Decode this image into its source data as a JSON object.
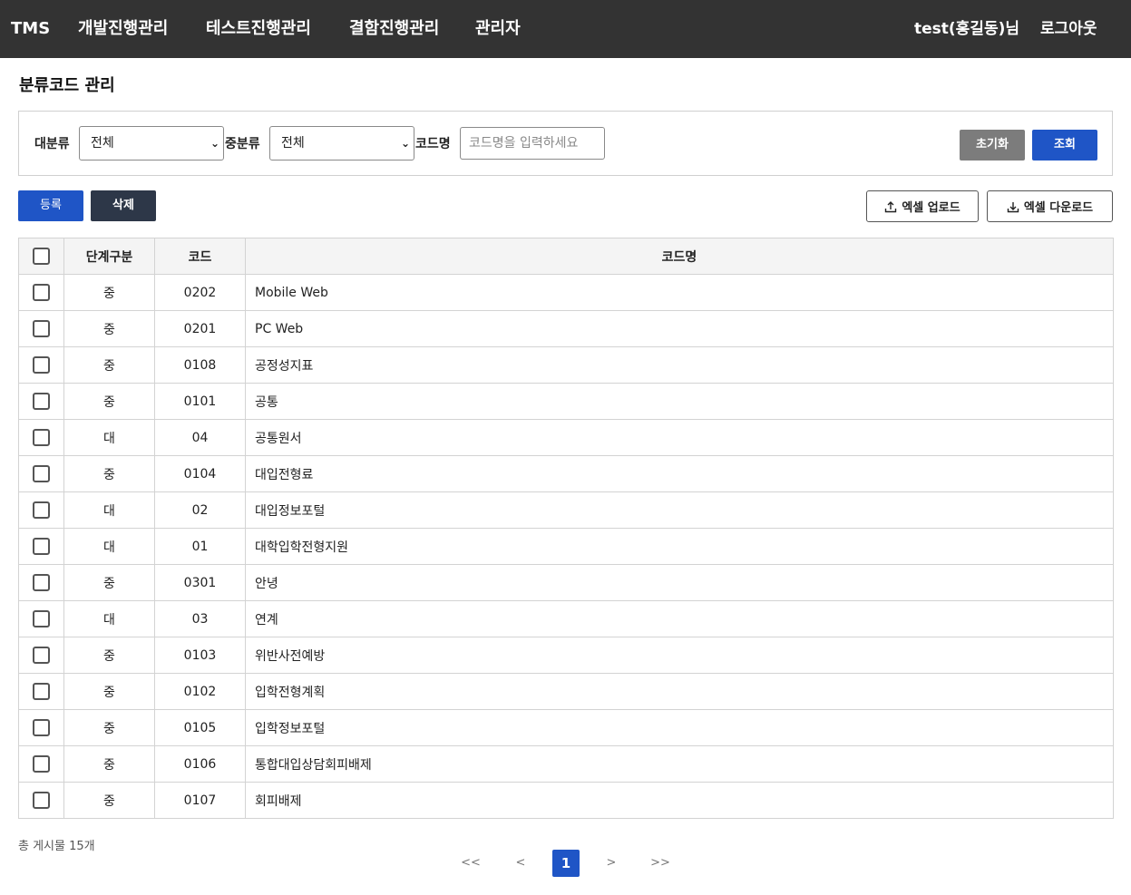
{
  "header": {
    "brand": "TMS",
    "nav": [
      {
        "label": "개발진행관리"
      },
      {
        "label": "테스트진행관리"
      },
      {
        "label": "결함진행관리"
      },
      {
        "label": "관리자"
      }
    ],
    "user": "test(홍길동)님",
    "logout": "로그아웃"
  },
  "page": {
    "title": "분류코드 관리"
  },
  "filters": {
    "major_label": "대분류",
    "major_value": "전체",
    "middle_label": "중분류",
    "middle_value": "전체",
    "name_label": "코드명",
    "name_placeholder": "코드명을 입력하세요",
    "reset_label": "초기화",
    "search_label": "조회"
  },
  "actions": {
    "register": "등록",
    "delete": "삭제",
    "excel_upload": "엑셀 업로드",
    "excel_download": "엑셀 다운로드"
  },
  "table": {
    "columns": [
      "단계구분",
      "코드",
      "코드명"
    ],
    "rows": [
      {
        "level": "중",
        "code": "0202",
        "name": "Mobile Web"
      },
      {
        "level": "중",
        "code": "0201",
        "name": "PC Web"
      },
      {
        "level": "중",
        "code": "0108",
        "name": "공정성지표"
      },
      {
        "level": "중",
        "code": "0101",
        "name": "공통"
      },
      {
        "level": "대",
        "code": "04",
        "name": "공통원서"
      },
      {
        "level": "중",
        "code": "0104",
        "name": "대입전형료"
      },
      {
        "level": "대",
        "code": "02",
        "name": "대입정보포털"
      },
      {
        "level": "대",
        "code": "01",
        "name": "대학입학전형지원"
      },
      {
        "level": "중",
        "code": "0301",
        "name": "안녕"
      },
      {
        "level": "대",
        "code": "03",
        "name": "연계"
      },
      {
        "level": "중",
        "code": "0103",
        "name": "위반사전예방"
      },
      {
        "level": "중",
        "code": "0102",
        "name": "입학전형계획"
      },
      {
        "level": "중",
        "code": "0105",
        "name": "입학정보포털"
      },
      {
        "level": "중",
        "code": "0106",
        "name": "통합대입상담회피배제"
      },
      {
        "level": "중",
        "code": "0107",
        "name": "회피배제"
      }
    ]
  },
  "footer": {
    "total": "총 게시물 15개",
    "pagination": {
      "first": "<<",
      "prev": "<",
      "current": "1",
      "next": ">",
      "last": ">>"
    }
  },
  "colors": {
    "topbar": "#333333",
    "primary": "#1f55c6",
    "dark_button": "#2d3748",
    "reset_button": "#7c7c7c"
  },
  "icons": [
    "upload-icon",
    "download-icon",
    "chevron-down-icon",
    "checkbox-icon"
  ]
}
